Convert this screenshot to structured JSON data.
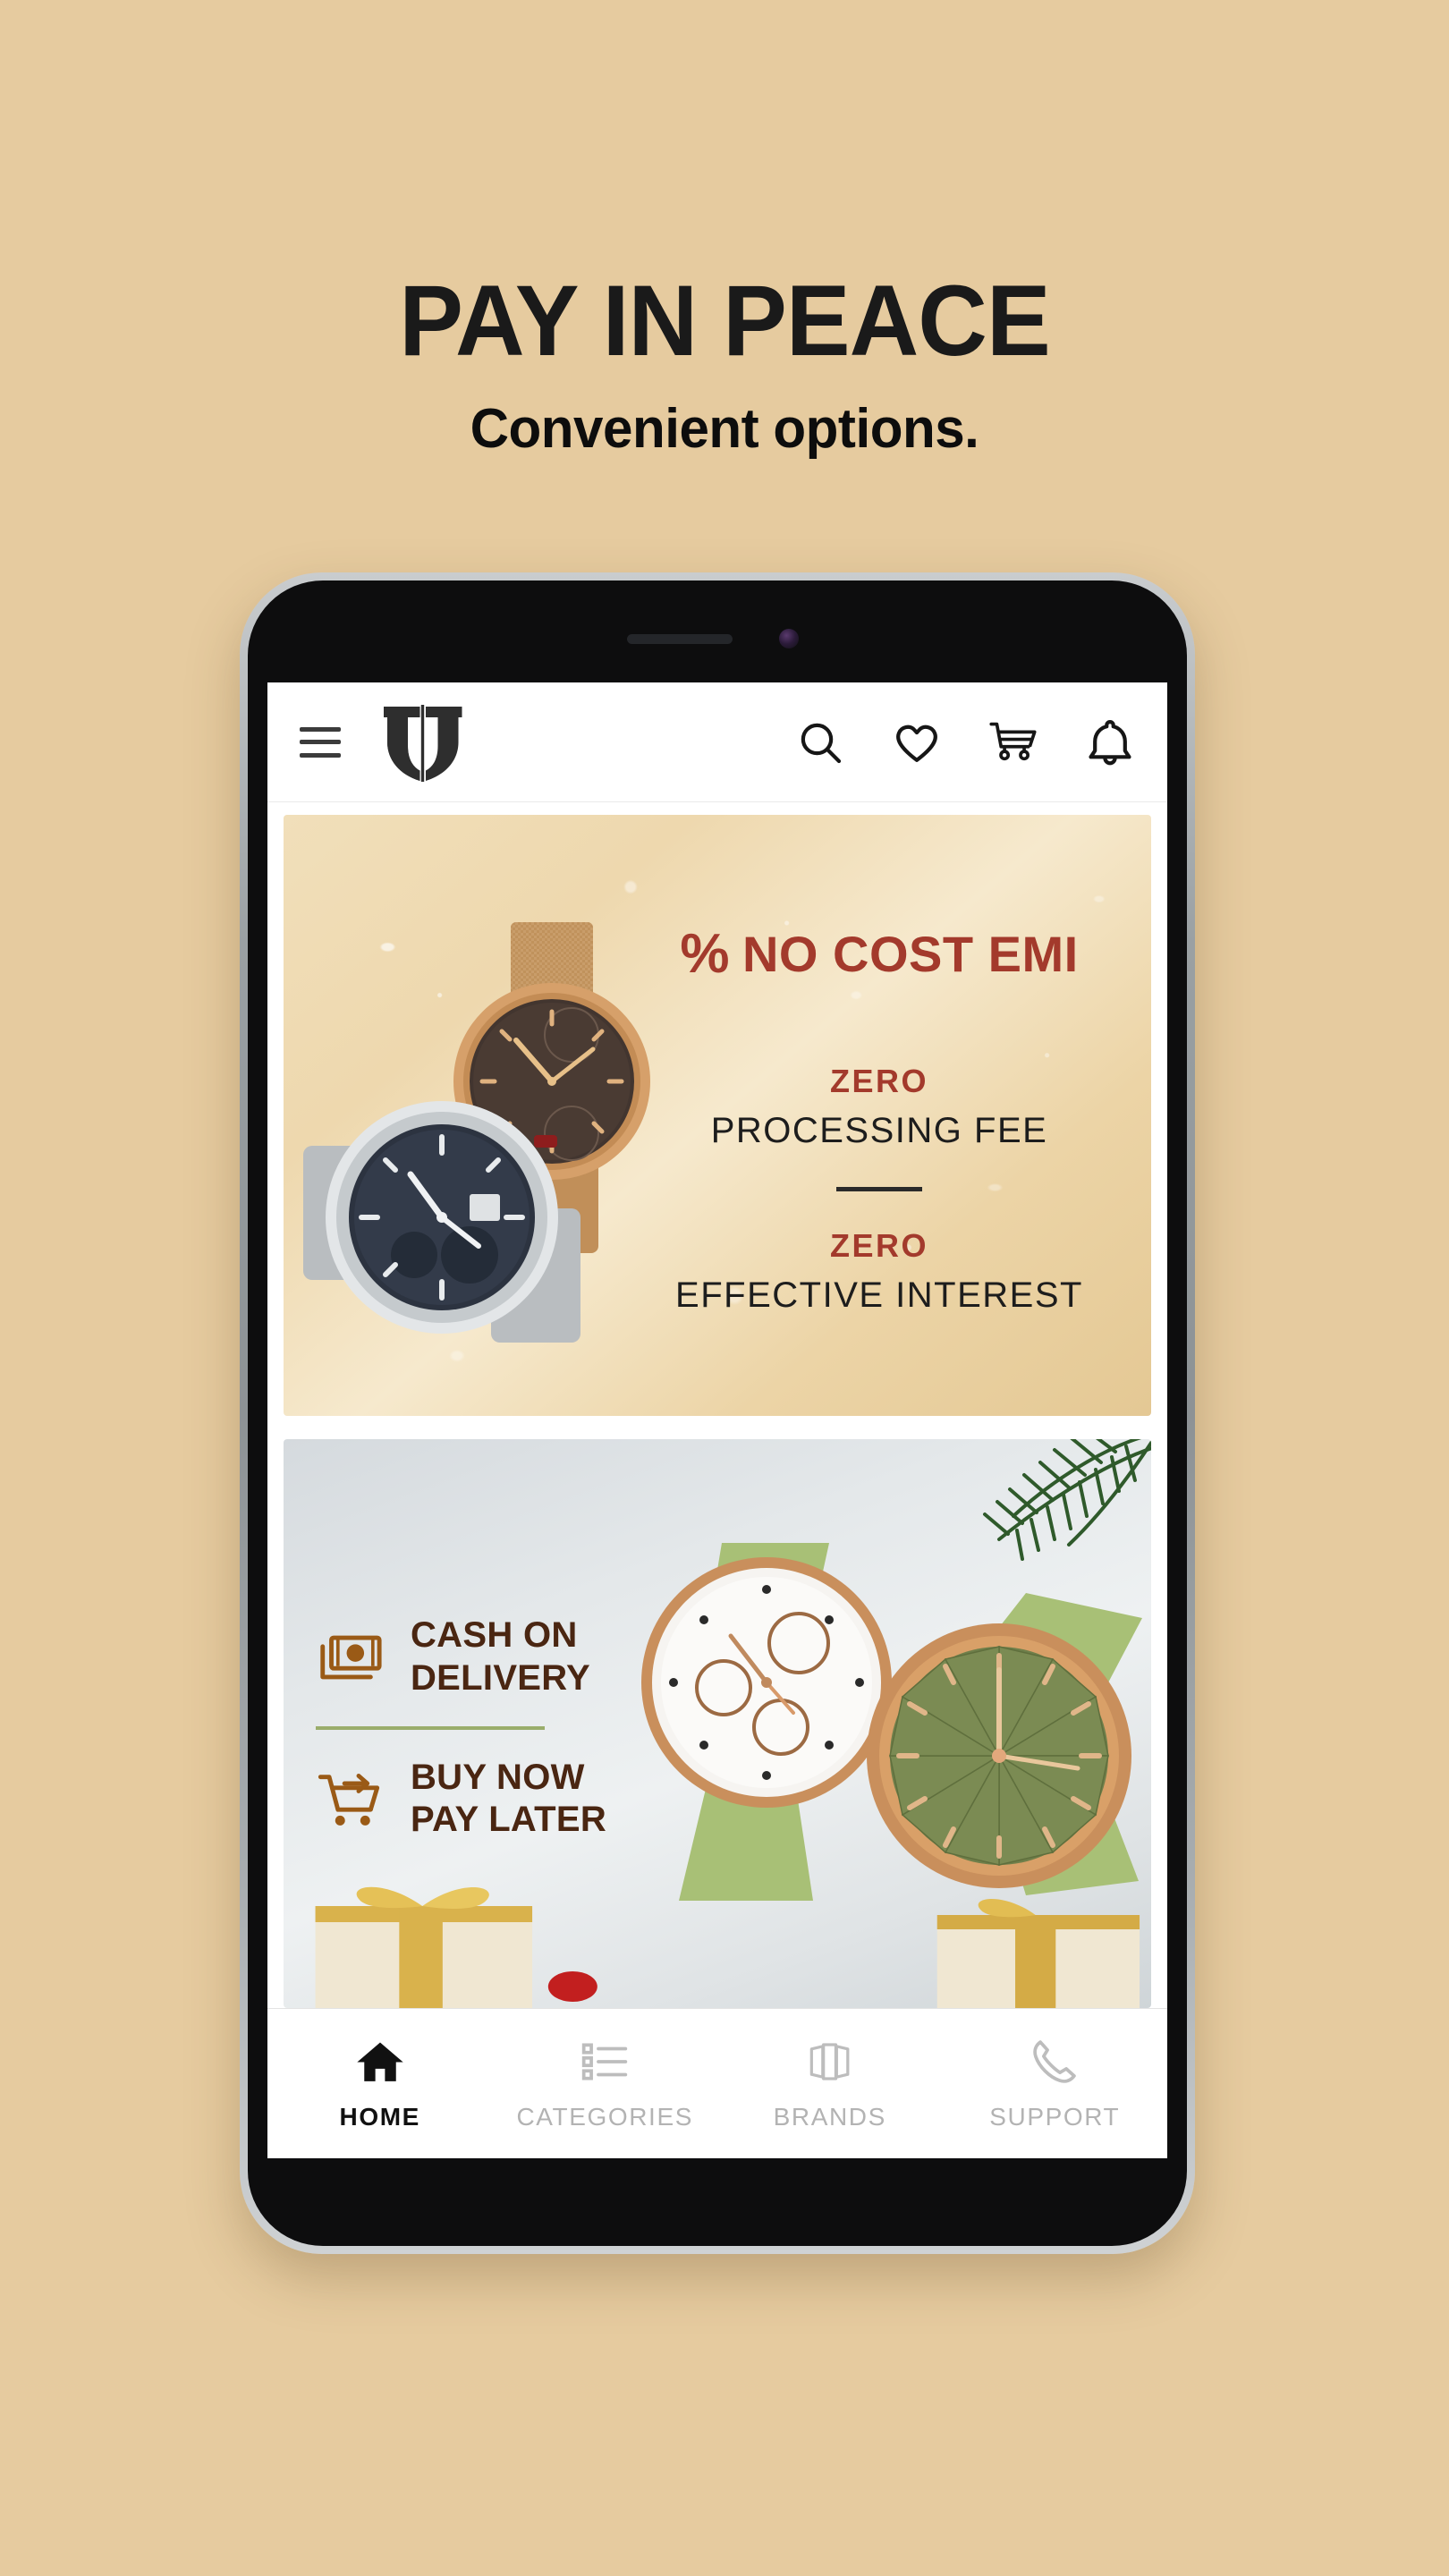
{
  "promo": {
    "title": "PAY IN PEACE",
    "subtitle": "Convenient options.",
    "bg_color": "#e6cb9f",
    "title_color": "#1a1a1a"
  },
  "app": {
    "header": {
      "menu_label": "menu",
      "logo_label": "Titan",
      "icons": [
        {
          "name": "search-icon",
          "label": "Search"
        },
        {
          "name": "heart-icon",
          "label": "Wishlist"
        },
        {
          "name": "cart-icon",
          "label": "Cart"
        },
        {
          "name": "bell-icon",
          "label": "Notifications"
        }
      ]
    },
    "banners": [
      {
        "id": "no-cost-emi",
        "percent_symbol": "%",
        "headline": "NO COST EMI",
        "headline_color": "#a33a2c",
        "benefits": [
          {
            "accent": "ZERO",
            "detail": "PROCESSING FEE"
          },
          {
            "accent": "ZERO",
            "detail": "EFFECTIVE INTEREST"
          }
        ],
        "detail_color": "#1d1d1d"
      },
      {
        "id": "cod-bnpl",
        "options": [
          {
            "icon": "cash-icon",
            "line1": "CASH ON",
            "line2": "DELIVERY"
          },
          {
            "icon": "cart-arrow-icon",
            "line1": "BUY NOW",
            "line2": "PAY LATER"
          }
        ],
        "text_color": "#4a2612",
        "divider_color": "#9aad6b"
      }
    ],
    "bottom_nav": [
      {
        "icon": "home-icon",
        "label": "HOME",
        "active": true
      },
      {
        "icon": "list-icon",
        "label": "CATEGORIES",
        "active": false
      },
      {
        "icon": "cards-icon",
        "label": "BRANDS",
        "active": false
      },
      {
        "icon": "phone-icon",
        "label": "SUPPORT",
        "active": false
      }
    ]
  }
}
